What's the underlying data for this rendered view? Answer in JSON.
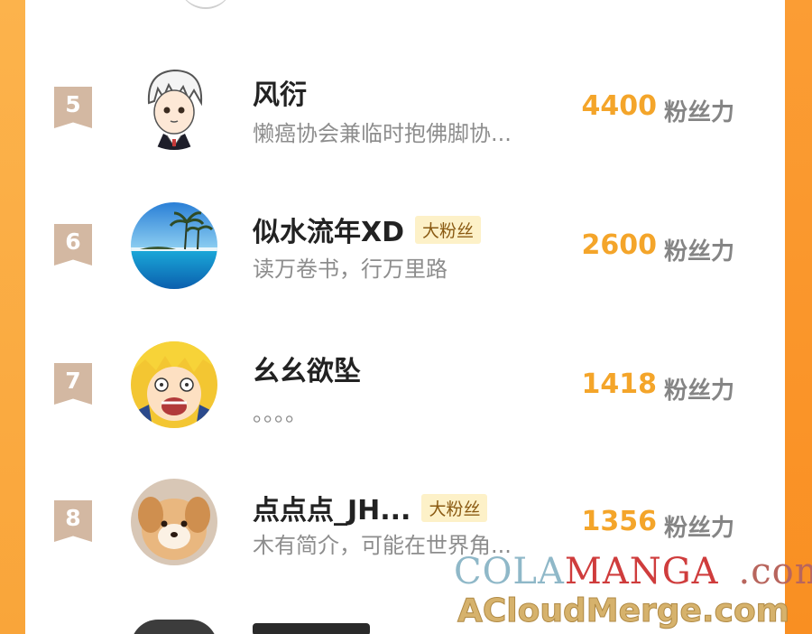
{
  "ranking": {
    "rows": [
      {
        "rank": "5",
        "name": "风衍",
        "tag": "",
        "bio": "懒癌协会兼临时抱佛脚协...",
        "score": "4400",
        "unit": "粉丝力"
      },
      {
        "rank": "6",
        "name": "似水流年XD",
        "tag": "大粉丝",
        "bio": "读万卷书，行万里路",
        "score": "2600",
        "unit": "粉丝力"
      },
      {
        "rank": "7",
        "name": "幺幺欲坠",
        "tag": "",
        "bio": "。。。。",
        "score": "1418",
        "unit": "粉丝力"
      },
      {
        "rank": "8",
        "name": "点点点_JH...",
        "tag": "大粉丝",
        "bio": "木有简介，可能在世界角...",
        "score": "1356",
        "unit": "粉丝力"
      }
    ]
  },
  "watermark": {
    "brand_a": "COLA",
    "brand_b": "MANGA",
    "domain": ".com",
    "line2": "ACloudMerge.com"
  },
  "colors": {
    "accent": "#f4a52a",
    "badge": "#d3b8a2",
    "tag_bg": "#fdf1c8",
    "side": "#fb9d34"
  }
}
